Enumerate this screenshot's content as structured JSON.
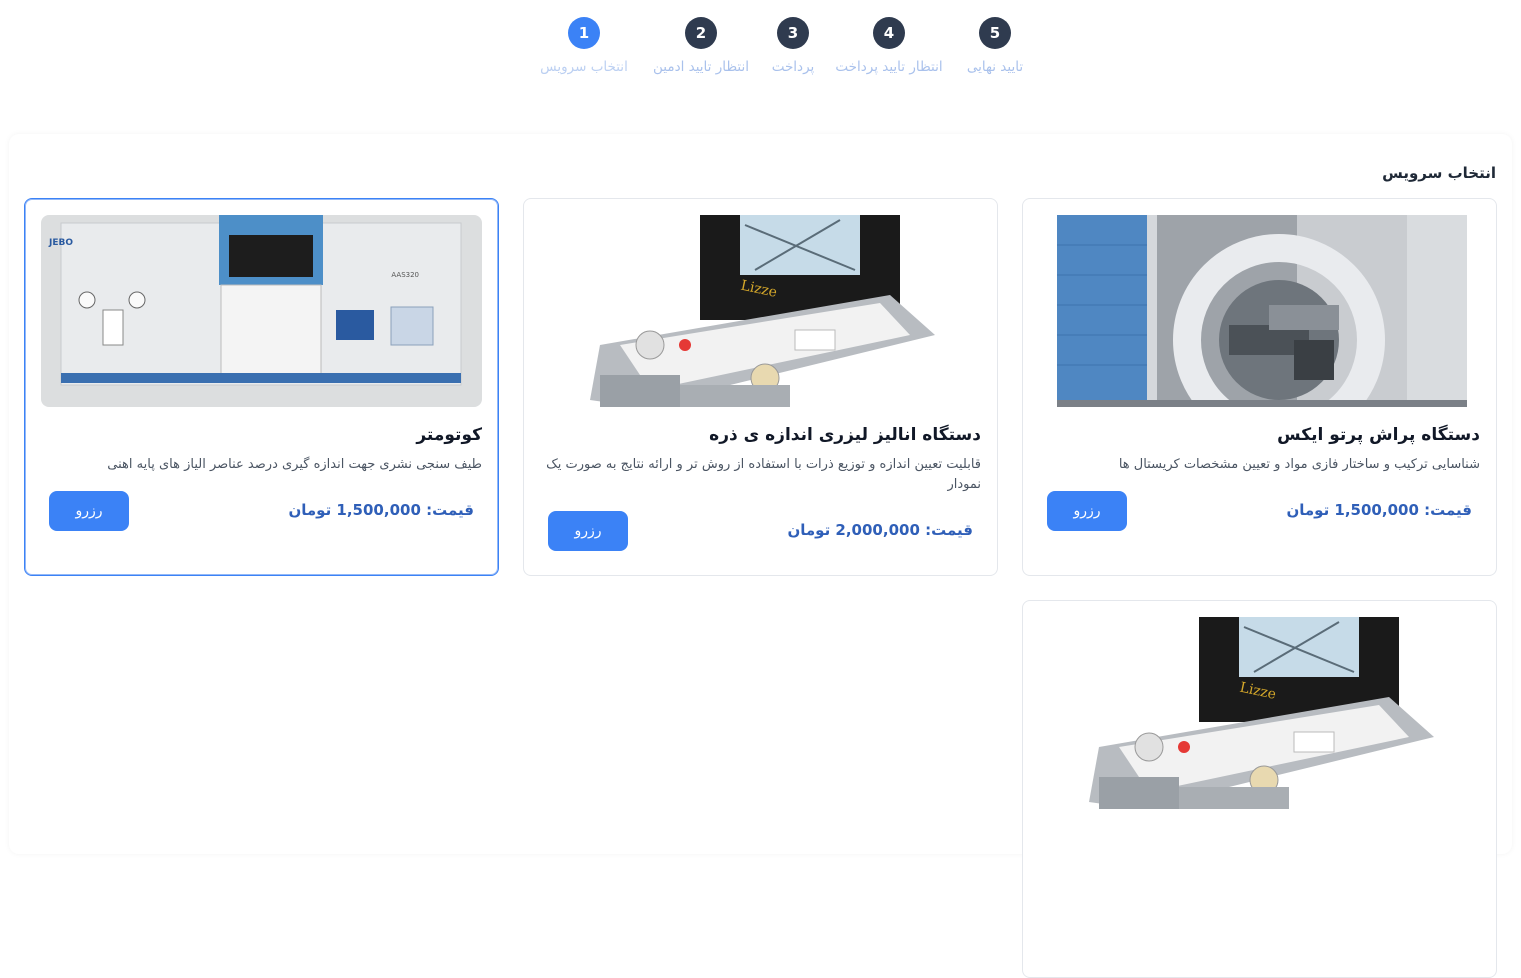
{
  "stepper": {
    "steps": [
      {
        "number": "1",
        "label": "انتخاب سرویس",
        "active": true
      },
      {
        "number": "2",
        "label": "انتظار تایید ادمین",
        "active": false
      },
      {
        "number": "3",
        "label": "پرداخت",
        "active": false
      },
      {
        "number": "4",
        "label": "انتظار تایید پرداخت",
        "active": false
      },
      {
        "number": "5",
        "label": "تایید نهایی",
        "active": false
      }
    ]
  },
  "section": {
    "title": "انتخاب سرویس"
  },
  "services": [
    {
      "title": "دستگاه پراش پرتو ایکس",
      "description": "شناسایی ترکیب و ساختار فازی مواد و تعیین مشخصات کریستال ها",
      "price": "قیمت: 1,500,000 تومان",
      "button": "رزرو",
      "image": "xrd-diffractometer-image",
      "selected": false
    },
    {
      "title": "دستگاه انالیز لیزری اندازه ی ذره",
      "description": "قابلیت تعیین اندازه و توزیع ذرات با استفاده از روش تر و ارائه نتایج به صورت یک نمودار",
      "price": "قیمت: 2,000,000 تومان",
      "button": "رزرو",
      "image": "laser-particle-analyzer-image",
      "selected": false
    },
    {
      "title": "کوتومتر",
      "description": "طیف سنجی نشری جهت اندازه گیری درصد عناصر الیاز های پایه اهنی",
      "price": "قیمت: 1,500,000 تومان",
      "button": "رزرو",
      "image": "spectrometer-image",
      "image_text": "AAS320",
      "selected": true
    },
    {
      "title": "",
      "image": "laser-particle-analyzer-image",
      "selected": false
    }
  ],
  "colors": {
    "accent": "#3b82f6",
    "step_inactive": "#2f3b4f",
    "price": "#2f5fb8"
  }
}
